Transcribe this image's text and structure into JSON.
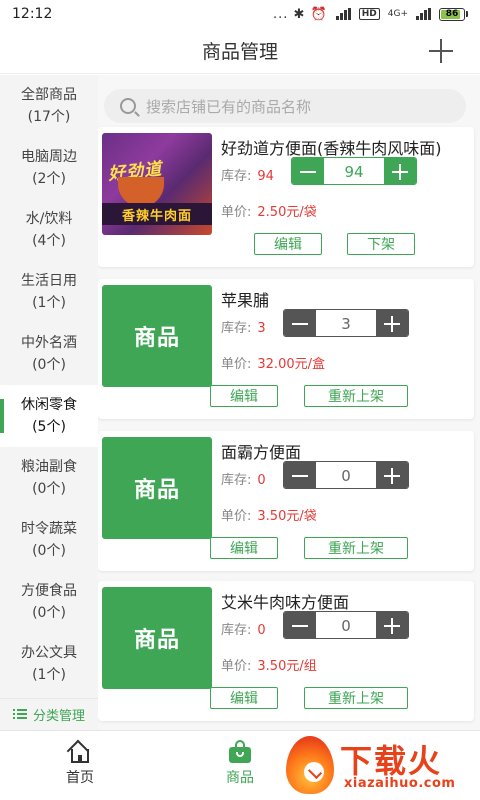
{
  "status_bar": {
    "time": "12:12",
    "icons_text": "... ✱ ⏰",
    "hd": "HD",
    "network": "4G+",
    "battery": "86",
    "battery_level": 0.86
  },
  "header": {
    "title": "商品管理"
  },
  "sidebar": {
    "items": [
      {
        "name": "全部商品",
        "count": "(17个)"
      },
      {
        "name": "电脑周边",
        "count": "(2个)"
      },
      {
        "name": "水/饮料",
        "count": "(4个)"
      },
      {
        "name": "生活日用",
        "count": "(1个)"
      },
      {
        "name": "中外名酒",
        "count": "(0个)"
      },
      {
        "name": "休闲零食",
        "count": "(5个)"
      },
      {
        "name": "粮油副食",
        "count": "(0个)"
      },
      {
        "name": "时令蔬菜",
        "count": "(0个)"
      },
      {
        "name": "方便食品",
        "count": "(0个)"
      },
      {
        "name": "办公文具",
        "count": "(1个)"
      }
    ],
    "active_index": 5,
    "footer_label": "分类管理"
  },
  "search": {
    "placeholder": "搜索店铺已有的商品名称"
  },
  "labels": {
    "stock": "库存:",
    "price": "单价:",
    "edit": "编辑",
    "take_down": "下架",
    "relist": "重新上架",
    "product_placeholder": "商品"
  },
  "products": [
    {
      "name": "好劲道方便面(香辣牛肉风味面)",
      "stock": "94",
      "quantity": "94",
      "price": "2.50元/袋",
      "image_text": "好劲道",
      "image_strip": "香辣牛肉面",
      "status": "on_sale"
    },
    {
      "name": "苹果脯",
      "stock": "3",
      "quantity": "3",
      "price": "32.00元/盒",
      "status": "off_sale"
    },
    {
      "name": "面霸方便面",
      "stock": "0",
      "quantity": "0",
      "price": "3.50元/袋",
      "status": "off_sale"
    },
    {
      "name": "艾米牛肉味方便面",
      "stock": "0",
      "quantity": "0",
      "price": "3.50元/组",
      "status": "off_sale"
    }
  ],
  "bottom_nav": {
    "home": "首页",
    "products": "商品"
  },
  "watermark": {
    "brand": "下载火",
    "domain": "xiazaihuo.com"
  },
  "colors": {
    "accent": "#3ea654",
    "price": "#e53935",
    "stepper_inactive": "#555555",
    "watermark": "#e9421b"
  }
}
